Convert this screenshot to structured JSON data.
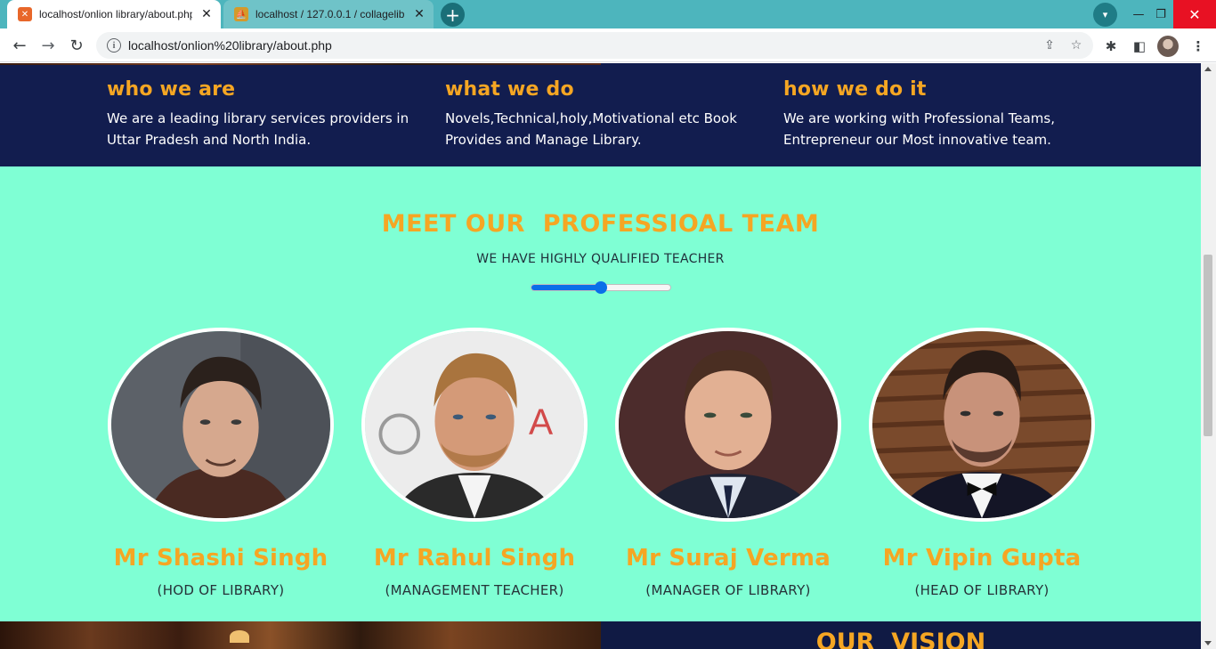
{
  "browser": {
    "tabs": [
      {
        "title": "localhost/onlion library/about.php",
        "favicon": "xampp-icon",
        "active": true
      },
      {
        "title": "localhost / 127.0.0.1 / collagelibrary",
        "favicon": "phpmyadmin-icon",
        "active": false
      }
    ],
    "new_tab_label": "+",
    "url": "localhost/onlion%20library/about.php",
    "info_glyph": "i",
    "colors": {
      "tabstrip": "#4db5bd",
      "close_button": "#e81123"
    }
  },
  "info_band": {
    "columns": [
      {
        "heading": "who we are",
        "text": "We are a leading library services providers in Uttar Pradesh and North India."
      },
      {
        "heading": "what we do",
        "text": "Novels,Technical,holy,Motivational etc Book Provides and Manage Library."
      },
      {
        "heading": "how we do it",
        "text": "We are working with Professional Teams, Entrepreneur our Most innovative team."
      }
    ],
    "colors": {
      "background": "#121d4f",
      "heading": "#f5a623",
      "text": "#ffffff"
    }
  },
  "team": {
    "title": "MEET OUR  PROFESSIOAL TEAM",
    "subtitle": "WE HAVE HIGHLY QUALIFIED TEACHER",
    "divider_level": 0.5,
    "members": [
      {
        "name": "Mr Shashi Singh",
        "role": "(HOD OF LIBRARY)"
      },
      {
        "name": "Mr Rahul Singh",
        "role": "(MANAGEMENT TEACHER)"
      },
      {
        "name": "Mr Suraj Verma",
        "role": "(MANAGER OF LIBRARY)"
      },
      {
        "name": "Mr Vipin Gupta",
        "role": "(HEAD OF LIBRARY)"
      }
    ],
    "colors": {
      "background": "#7fffd4",
      "accent": "#f5a623",
      "divider": "#0a6fe8"
    }
  },
  "vision": {
    "title": "OUR  VISION"
  }
}
